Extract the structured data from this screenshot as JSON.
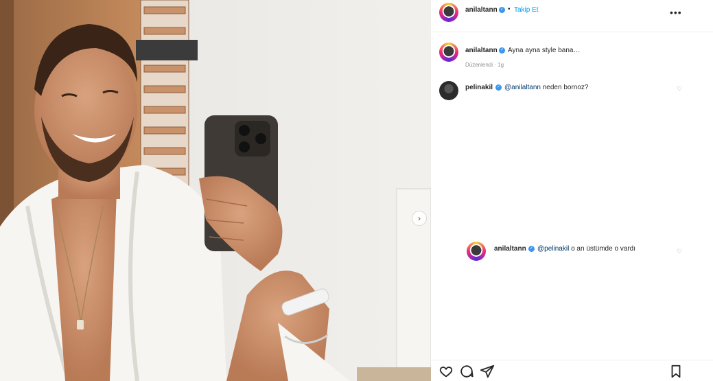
{
  "post": {
    "author": "anilaltann",
    "follow_label": "Takip Et",
    "separator": "•",
    "more_label": "•••"
  },
  "caption": {
    "username": "anilaltann",
    "text": "Ayna ayna style bana…",
    "meta": "Düzenlendi · 1g"
  },
  "comments": [
    {
      "username": "pelinakil",
      "mention": "@anilaltann",
      "text": "neden bornoz?"
    },
    {
      "username": "anilaltann",
      "mention": "@pelinakil",
      "text": "o an üstümde o vardı"
    }
  ],
  "actions": {
    "like": "heart-icon",
    "comment": "comment-icon",
    "share": "share-icon",
    "save": "bookmark-icon"
  },
  "colors": {
    "link": "#0095f6",
    "verified": "#3897f0",
    "mention": "#00376b",
    "muted": "#8e8e8e"
  }
}
